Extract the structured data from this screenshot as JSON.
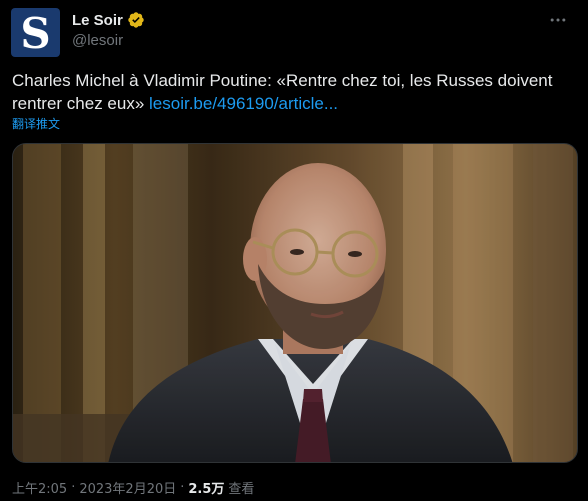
{
  "account": {
    "display_name": "Le Soir",
    "handle": "@lesoir",
    "avatar_letter": "S",
    "avatar_color": "#1a3a6e",
    "verified_badge": "gold-verified-icon"
  },
  "tweet": {
    "text": "Charles Michel à Vladimir Poutine: «Rentre chez toi, les Russes doivent rentrer chez eux» ",
    "link_text": "lesoir.be/496190/article...",
    "translate_label": "翻译推文"
  },
  "footer": {
    "time": "上午2:05",
    "separator": "·",
    "date": "2023年2月20日",
    "views_count": "2.5万",
    "views_label": "查看"
  },
  "icons": {
    "more": "more-options-icon"
  },
  "colors": {
    "background": "#000000",
    "text": "#e7e9ea",
    "secondary_text": "#71767b",
    "link": "#1d9bf0",
    "verified_gold": "#e2b719"
  }
}
